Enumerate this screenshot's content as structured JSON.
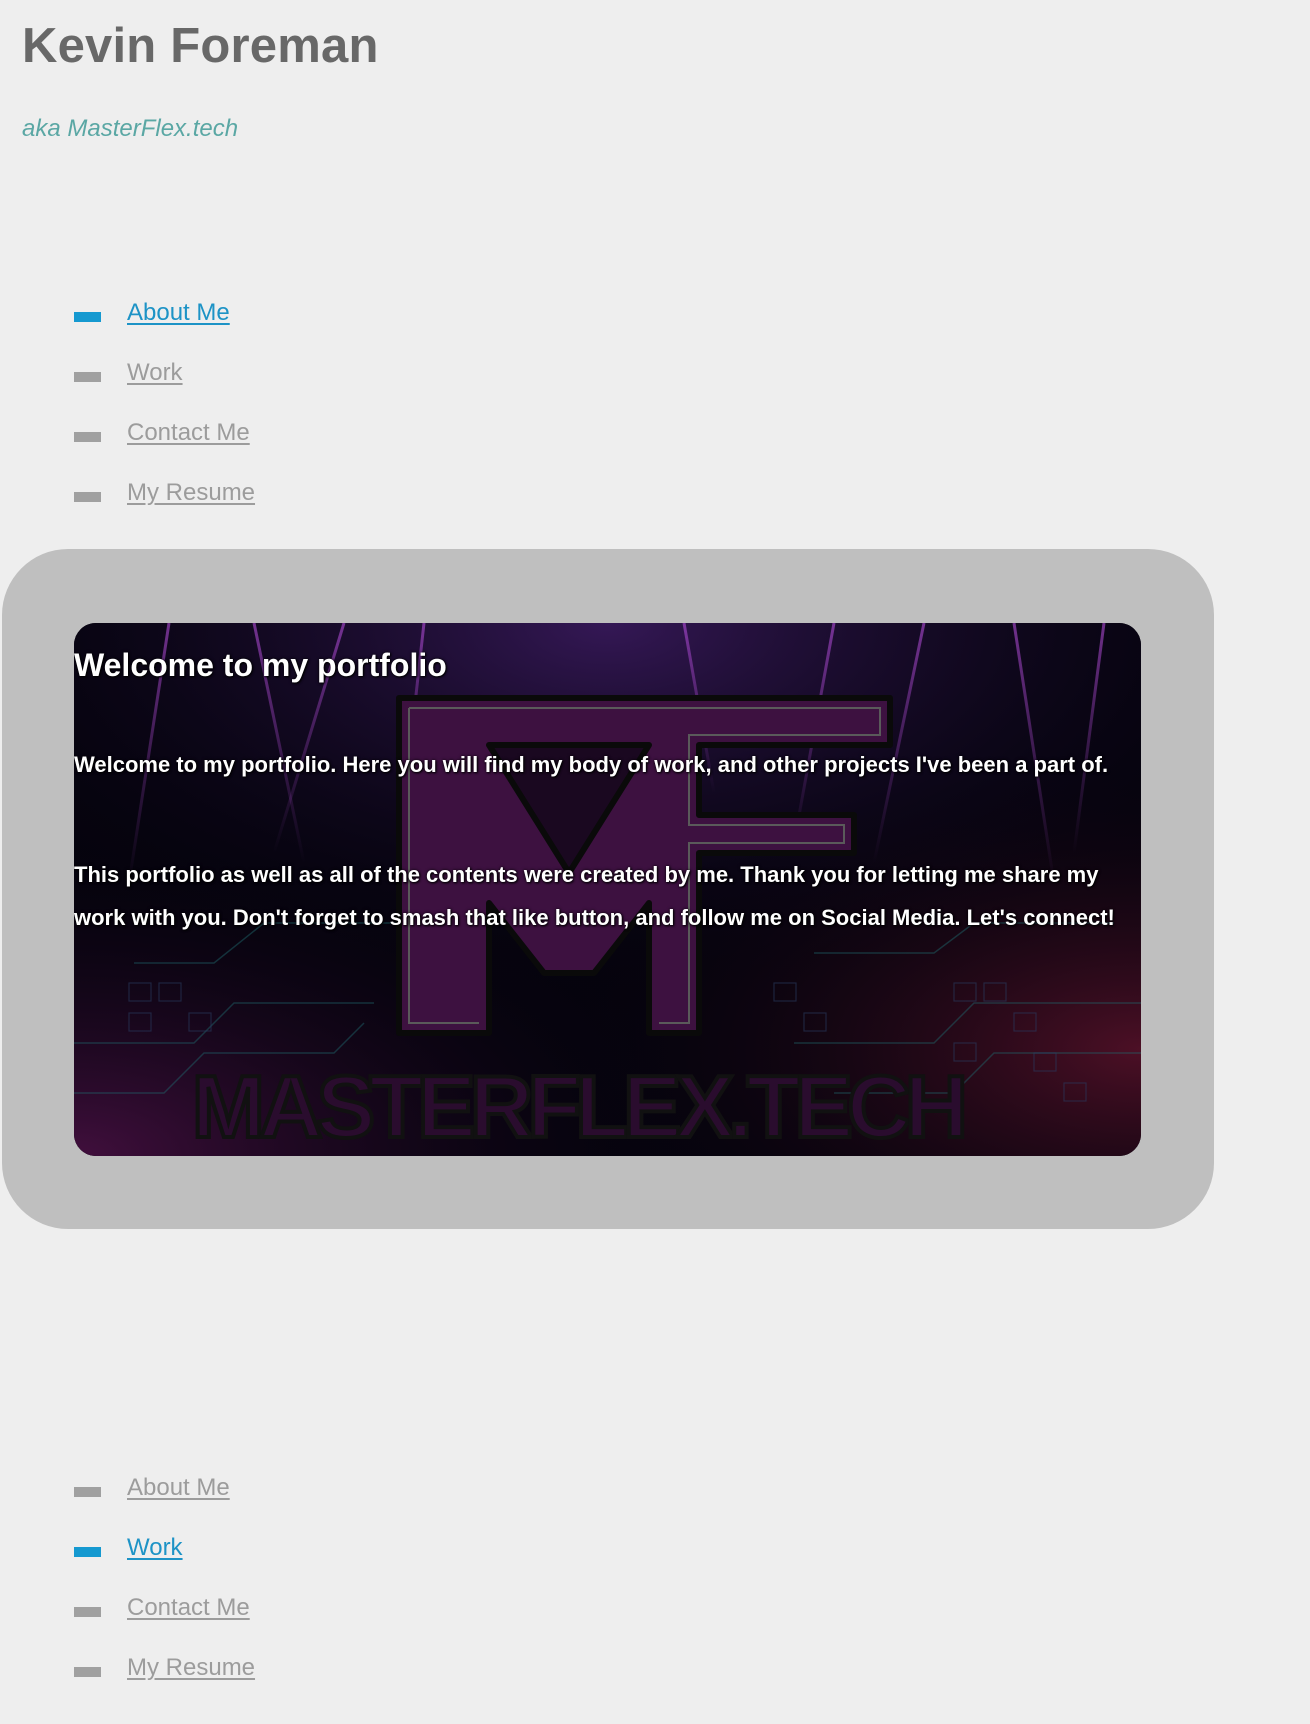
{
  "header": {
    "title": "Kevin Foreman",
    "tagline": "aka MasterFlex.tech"
  },
  "nav_top": {
    "items": [
      {
        "label": "About Me",
        "active": true
      },
      {
        "label": "Work",
        "active": false
      },
      {
        "label": "Contact Me",
        "active": false
      },
      {
        "label": "My Resume",
        "active": false
      }
    ]
  },
  "hero": {
    "heading": "Welcome to my portfolio",
    "paragraph_1": "Welcome to my portfolio. Here you will find my body of work, and other projects I've been a part of.",
    "paragraph_2": "This portfolio as well as all of the contents were created by me. Thank you for letting me share my work with you. Don't forget to smash that like button, and follow me on Social Media. Let's connect!",
    "logo_monogram": "MF",
    "logo_wordmark": "MASTERFLEX.TECH"
  },
  "nav_bottom": {
    "items": [
      {
        "label": "About Me",
        "active": false
      },
      {
        "label": "Work",
        "active": true
      },
      {
        "label": "Contact Me",
        "active": false
      },
      {
        "label": "My Resume",
        "active": false
      }
    ]
  },
  "colors": {
    "page_background": "#eeeeee",
    "title": "#686868",
    "tagline": "#5aa7a4",
    "nav_active": "#1599d0",
    "nav_inactive": "#9c9c9c",
    "panel": "#bfbfbf",
    "hero_text": "#ffffff",
    "logo_purple": "#3d1140"
  }
}
